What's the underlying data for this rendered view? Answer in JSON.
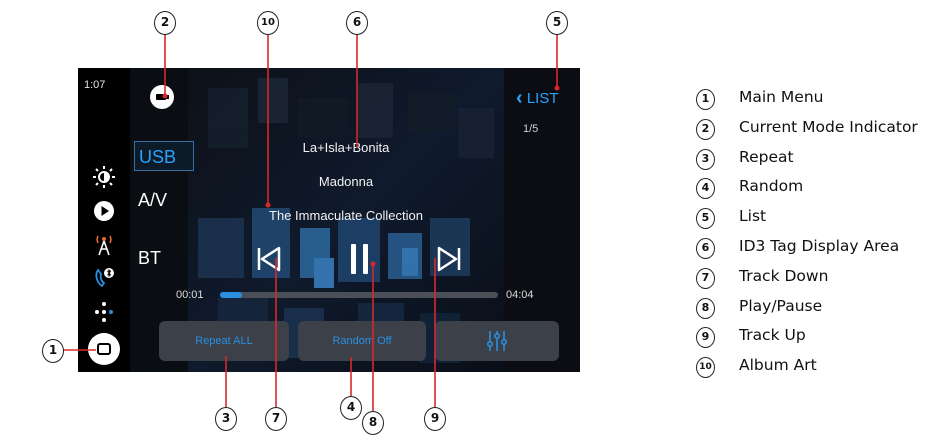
{
  "screen": {
    "clock": "1:07",
    "modes": [
      "USB",
      "A/V",
      "BT"
    ],
    "list_label": "LIST",
    "track_count": "1/5",
    "id3": {
      "title": "La+Isla+Bonita",
      "artist": "Madonna",
      "album": "The Immaculate Collection"
    },
    "time_elapsed": "00:01",
    "time_total": "04:04",
    "progress_fraction": 0.08,
    "repeat_label": "Repeat ALL",
    "random_label": "Random  Off",
    "accent_color": "#2a8fe0"
  },
  "callouts": [
    "1",
    "2",
    "3",
    "4",
    "5",
    "6",
    "7",
    "8",
    "9",
    "10"
  ],
  "legend": [
    {
      "num": "1",
      "label": "Main Menu"
    },
    {
      "num": "2",
      "label": "Current Mode Indicator"
    },
    {
      "num": "3",
      "label": "Repeat"
    },
    {
      "num": "4",
      "label": "Random"
    },
    {
      "num": "5",
      "label": "List"
    },
    {
      "num": "6",
      "label": "ID3 Tag Display Area"
    },
    {
      "num": "7",
      "label": "Track Down"
    },
    {
      "num": "8",
      "label": "Play/Pause"
    },
    {
      "num": "9",
      "label": "Track Up"
    },
    {
      "num": "10",
      "label": "Album Art"
    }
  ]
}
